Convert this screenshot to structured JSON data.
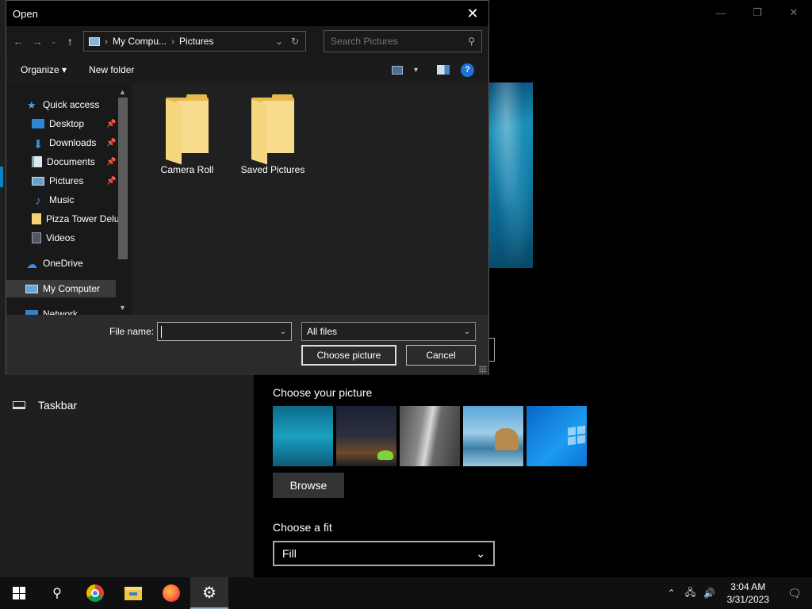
{
  "settings": {
    "nav_taskbar": "Taskbar",
    "choose_picture_heading": "Choose your picture",
    "browse_label": "Browse",
    "choose_fit_heading": "Choose a fit",
    "fit_value": "Fill"
  },
  "dialog": {
    "title": "Open",
    "address": [
      "My Compu...",
      "Pictures"
    ],
    "search_placeholder": "Search Pictures",
    "toolbar": {
      "organize": "Organize",
      "new_folder": "New folder"
    },
    "nav_items": [
      {
        "label": "Quick access",
        "icon": "star-icon",
        "pinned": false
      },
      {
        "label": "Desktop",
        "icon": "desktop-icon",
        "pinned": true
      },
      {
        "label": "Downloads",
        "icon": "download-icon",
        "pinned": true
      },
      {
        "label": "Documents",
        "icon": "documents-icon",
        "pinned": true
      },
      {
        "label": "Pictures",
        "icon": "pictures-icon",
        "pinned": true
      },
      {
        "label": "Music",
        "icon": "music-icon",
        "pinned": false
      },
      {
        "label": "Pizza Tower Delu",
        "icon": "folder-icon",
        "pinned": false
      },
      {
        "label": "Videos",
        "icon": "videos-icon",
        "pinned": false
      },
      {
        "label": "OneDrive",
        "icon": "cloud-icon",
        "pinned": false
      },
      {
        "label": "My Computer",
        "icon": "computer-icon",
        "pinned": false
      },
      {
        "label": "Network",
        "icon": "network-icon",
        "pinned": false
      }
    ],
    "folders": [
      "Camera Roll",
      "Saved Pictures"
    ],
    "file_name_label": "File name:",
    "file_name_value": "",
    "file_type": "All files",
    "choose_button": "Choose picture",
    "cancel_button": "Cancel"
  },
  "taskbar": {
    "time": "3:04 AM",
    "date": "3/31/2023"
  },
  "colors": {
    "accent": "#0a84c6",
    "folder": "#f6dc8c"
  }
}
